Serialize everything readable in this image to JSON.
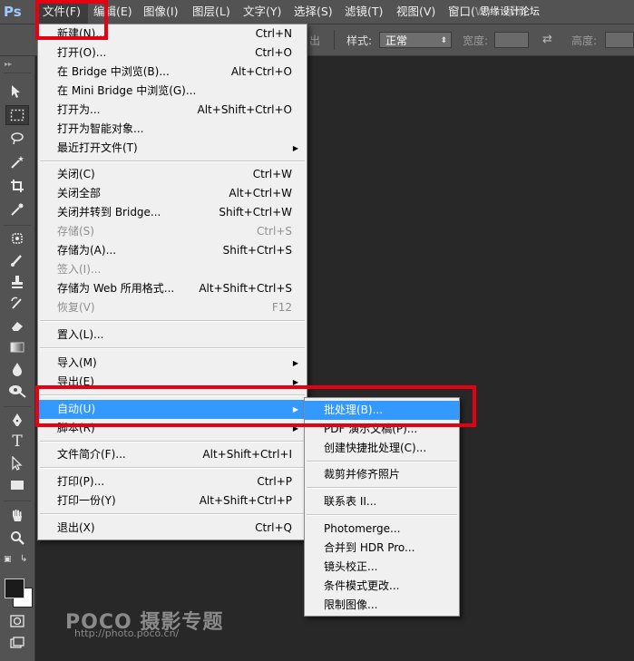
{
  "menubar": {
    "logo": "Ps",
    "items": [
      {
        "label": "文件(F)"
      },
      {
        "label": "编辑(E)"
      },
      {
        "label": "图像(I)"
      },
      {
        "label": "图层(L)"
      },
      {
        "label": "文字(Y)"
      },
      {
        "label": "选择(S)"
      },
      {
        "label": "滤镜(T)"
      },
      {
        "label": "视图(V)"
      },
      {
        "label": "窗口(W)"
      },
      {
        "label": "帮助"
      }
    ],
    "watermark": "思缘设计论坛 WWW.MISSYUAN.COM"
  },
  "options_bar": {
    "partial_label": "出",
    "style_label": "样式:",
    "style_value": "正常",
    "width_label": "宽度:",
    "height_label": "高度:"
  },
  "file_menu": {
    "groups": [
      [
        {
          "label": "新建(N)...",
          "shortcut": "Ctrl+N"
        },
        {
          "label": "打开(O)...",
          "shortcut": "Ctrl+O"
        },
        {
          "label": "在 Bridge 中浏览(B)...",
          "shortcut": "Alt+Ctrl+O"
        },
        {
          "label": "在 Mini Bridge 中浏览(G)...",
          "shortcut": ""
        },
        {
          "label": "打开为...",
          "shortcut": "Alt+Shift+Ctrl+O"
        },
        {
          "label": "打开为智能对象...",
          "shortcut": ""
        },
        {
          "label": "最近打开文件(T)",
          "shortcut": "",
          "submenu": true
        }
      ],
      [
        {
          "label": "关闭(C)",
          "shortcut": "Ctrl+W"
        },
        {
          "label": "关闭全部",
          "shortcut": "Alt+Ctrl+W"
        },
        {
          "label": "关闭并转到 Bridge...",
          "shortcut": "Shift+Ctrl+W"
        },
        {
          "label": "存储(S)",
          "shortcut": "Ctrl+S",
          "disabled": true
        },
        {
          "label": "存储为(A)...",
          "shortcut": "Shift+Ctrl+S"
        },
        {
          "label": "签入(I)...",
          "shortcut": "",
          "disabled": true
        },
        {
          "label": "存储为 Web 所用格式...",
          "shortcut": "Alt+Shift+Ctrl+S"
        },
        {
          "label": "恢复(V)",
          "shortcut": "F12",
          "disabled": true
        }
      ],
      [
        {
          "label": "置入(L)...",
          "shortcut": ""
        }
      ],
      [
        {
          "label": "导入(M)",
          "shortcut": "",
          "submenu": true
        },
        {
          "label": "导出(E)",
          "shortcut": "",
          "submenu": true
        }
      ],
      [
        {
          "label": "自动(U)",
          "shortcut": "",
          "submenu": true,
          "highlighted": true
        },
        {
          "label": "脚本(R)",
          "shortcut": "",
          "submenu": true
        }
      ],
      [
        {
          "label": "文件简介(F)...",
          "shortcut": "Alt+Shift+Ctrl+I"
        }
      ],
      [
        {
          "label": "打印(P)...",
          "shortcut": "Ctrl+P"
        },
        {
          "label": "打印一份(Y)",
          "shortcut": "Alt+Shift+Ctrl+P"
        }
      ],
      [
        {
          "label": "退出(X)",
          "shortcut": "Ctrl+Q"
        }
      ]
    ]
  },
  "automate_submenu": {
    "groups": [
      [
        {
          "label": "批处理(B)...",
          "highlighted": true
        },
        {
          "label": "PDF 演示文稿(P)..."
        },
        {
          "label": "创建快捷批处理(C)..."
        }
      ],
      [
        {
          "label": "裁剪并修齐照片"
        }
      ],
      [
        {
          "label": "联系表 II..."
        }
      ],
      [
        {
          "label": "Photomerge..."
        },
        {
          "label": "合并到 HDR Pro..."
        },
        {
          "label": "镜头校正..."
        },
        {
          "label": "条件模式更改..."
        },
        {
          "label": "限制图像..."
        }
      ]
    ]
  },
  "watermark_bottom": {
    "brand": "POCO 摄影专题",
    "url": "http://photo.poco.cn/"
  },
  "colors": {
    "highlight": "#3399ff",
    "annotation_red": "#e50012",
    "ui_gray": "#535353",
    "canvas": "#282828"
  }
}
